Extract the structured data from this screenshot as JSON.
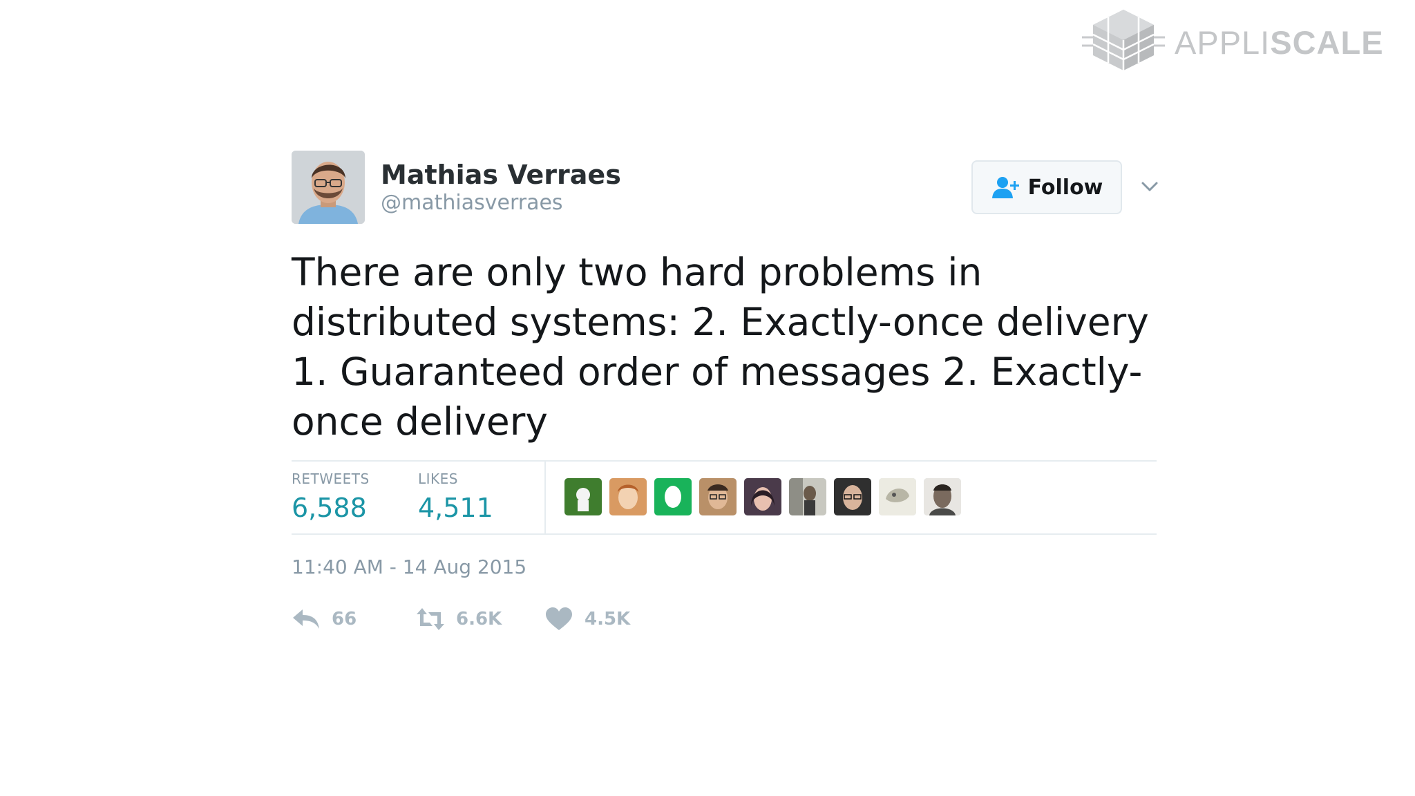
{
  "brand": {
    "text_light": "APPLI",
    "text_bold": "SCALE",
    "logo_icon": "cube-logo-icon",
    "color": "#c4c6c8"
  },
  "tweet": {
    "author": {
      "name": "Mathias Verraes",
      "handle": "@mathiasverraes",
      "avatar_icon": "profile-photo"
    },
    "follow_button": {
      "label": "Follow",
      "icon": "add-user-icon"
    },
    "menu_icon": "chevron-down-icon",
    "text": "There are only two hard problems in distributed systems:  2. Exactly-once delivery 1. Guaranteed order of messages 2. Exactly-once delivery",
    "stats": {
      "retweets_label": "RETWEETS",
      "retweets_value": "6,588",
      "likes_label": "LIKES",
      "likes_value": "4,511"
    },
    "likers": [
      {
        "name": "liker-avatar-1",
        "color": "#3f7d2e"
      },
      {
        "name": "liker-avatar-2",
        "color": "#d99a62"
      },
      {
        "name": "liker-avatar-3",
        "color": "#19b35a"
      },
      {
        "name": "liker-avatar-4",
        "color": "#b99068"
      },
      {
        "name": "liker-avatar-5",
        "color": "#4a3a4a"
      },
      {
        "name": "liker-avatar-6",
        "color": "#8e8e86"
      },
      {
        "name": "liker-avatar-7",
        "color": "#2f2f2f"
      },
      {
        "name": "liker-avatar-8",
        "color": "#d9d6c8"
      },
      {
        "name": "liker-avatar-9",
        "color": "#6a6560"
      }
    ],
    "timestamp": "11:40 AM - 14 Aug 2015",
    "actions": {
      "reply": {
        "icon": "reply-icon",
        "count": "66"
      },
      "retweet": {
        "icon": "retweet-icon",
        "count": "6.6K"
      },
      "like": {
        "icon": "heart-icon",
        "count": "4.5K"
      }
    },
    "colors": {
      "accent": "#1b95a6",
      "follow_icon": "#1da1f2",
      "muted": "#8899a6",
      "action_icon": "#aab8c2"
    }
  }
}
